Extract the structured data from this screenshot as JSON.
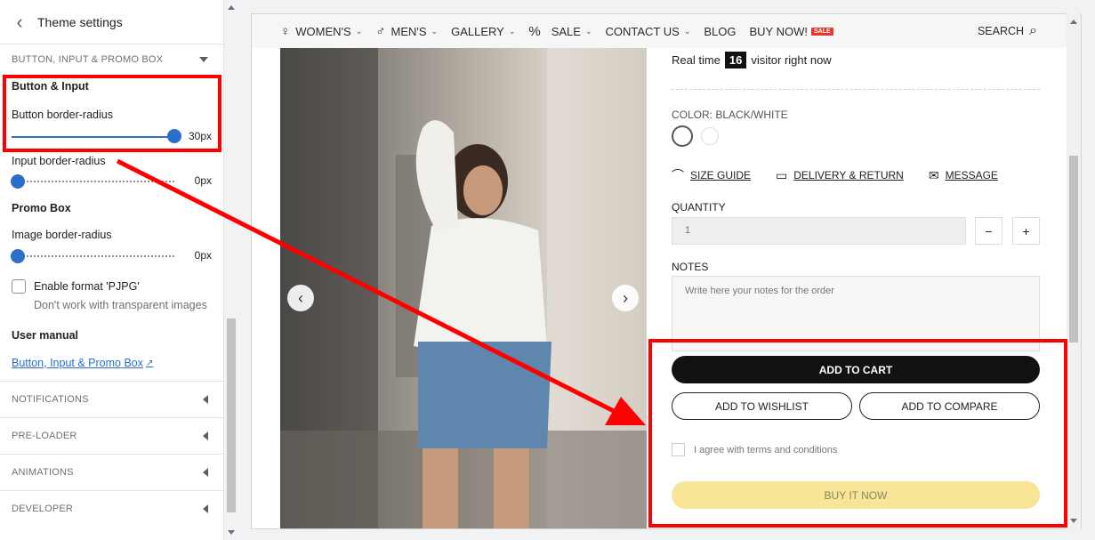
{
  "sidebar": {
    "title": "Theme settings",
    "section_header": "BUTTON, INPUT & PROMO BOX",
    "button_input": {
      "heading": "Button & Input",
      "button_radius_label": "Button border-radius",
      "button_radius_value": "30px",
      "button_radius_level": 1.0,
      "input_radius_label": "Input border-radius",
      "input_radius_value": "0px",
      "input_radius_level": 0.0
    },
    "promo_box": {
      "heading": "Promo Box",
      "image_radius_label": "Image border-radius",
      "image_radius_value": "0px",
      "image_radius_level": 0.0,
      "pjpg_label": "Enable format 'PJPG'",
      "pjpg_checked": false,
      "pjpg_help": "Don't work with transparent images"
    },
    "user_manual": {
      "heading": "User manual",
      "link": "Button, Input & Promo Box"
    },
    "collapsed_sections": [
      "NOTIFICATIONS",
      "PRE-LOADER",
      "ANIMATIONS",
      "DEVELOPER"
    ]
  },
  "preview": {
    "nav": {
      "items": [
        "WOMEN'S",
        "MEN'S",
        "GALLERY",
        "SALE",
        "CONTACT US",
        "BLOG",
        "BUY NOW!"
      ],
      "sale_badge": "SALE",
      "search": "SEARCH"
    },
    "product": {
      "realtime_prefix": "Real time",
      "realtime_count": "16",
      "realtime_suffix": "visitor right now",
      "color_label": "COLOR: BLACK/WHITE",
      "size_guide": "SIZE GUIDE",
      "delivery_return": "DELIVERY & RETURN",
      "message": "MESSAGE",
      "quantity_label": "QUANTITY",
      "quantity_value": "1",
      "minus": "−",
      "plus": "+",
      "notes_label": "NOTES",
      "notes_placeholder": "Write here your notes for the order",
      "add_to_cart": "ADD TO CART",
      "add_to_wishlist": "ADD TO WISHLIST",
      "add_to_compare": "ADD TO COMPARE",
      "agree_text": "I agree with terms and conditions",
      "buy_it_now": "BUY IT NOW"
    }
  },
  "colors": {
    "accent": "#2c6ecb",
    "annotation": "#ff0000",
    "buy_now": "#f8e598"
  }
}
